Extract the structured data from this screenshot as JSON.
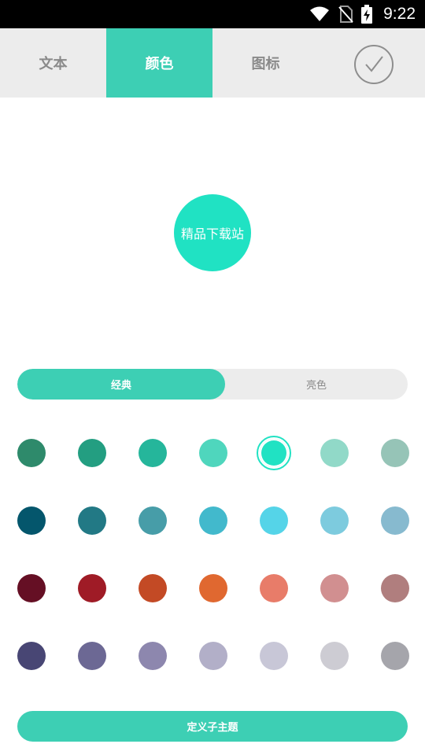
{
  "status_bar": {
    "time": "9:22",
    "icons": [
      "wifi-icon",
      "no-sim-icon",
      "battery-charging-icon"
    ]
  },
  "tabs": [
    {
      "label": "文本",
      "active": false
    },
    {
      "label": "颜色",
      "active": true
    },
    {
      "label": "图标",
      "active": false
    }
  ],
  "confirm_icon": "checkmark-circle-icon",
  "preview": {
    "text": "精品下载站",
    "color": "#20e2c3"
  },
  "segment": {
    "options": [
      "经典",
      "亮色"
    ],
    "selected": "经典"
  },
  "palette": {
    "selected_row": 0,
    "selected_col": 4,
    "rows": [
      [
        "#2e8a6b",
        "#239e81",
        "#25b69b",
        "#4fd6bd",
        "#20e2c3",
        "#91d9c8",
        "#96c4b7"
      ],
      [
        "#04566c",
        "#227985",
        "#479da8",
        "#42b9cc",
        "#55d4e8",
        "#7dcbde",
        "#87bacf"
      ],
      [
        "#650f24",
        "#9f1b26",
        "#c34a25",
        "#e06830",
        "#e87c69",
        "#d18f90",
        "#b07e7e"
      ],
      [
        "#484674",
        "#6c6894",
        "#8d87ae",
        "#b2afc8",
        "#c8c7d7",
        "#cdccd3",
        "#a5a5ab"
      ]
    ]
  },
  "custom_button": {
    "label": "定义子主题"
  },
  "colors": {
    "accent": "#3dcfb4",
    "tab_bg": "#ececec"
  }
}
